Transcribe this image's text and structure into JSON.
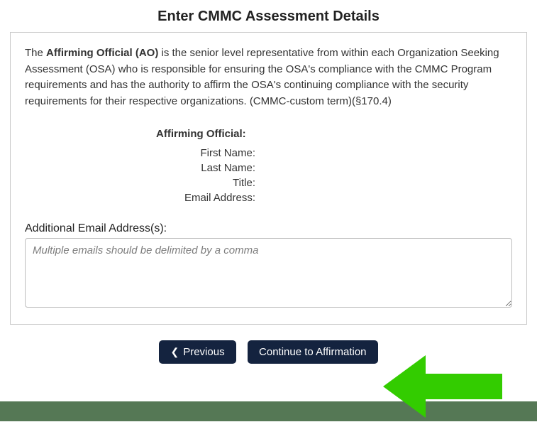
{
  "title": "Enter CMMC Assessment Details",
  "description": {
    "bold": "Affirming Official (AO)",
    "text_before": "The ",
    "text_after": " is the senior level representative from within each Organization Seeking Assessment (OSA) who is responsible for ensuring the OSA's compliance with the CMMC Program requirements and has the authority to affirm the OSA's continuing compliance with the security requirements for their respective organizations. (CMMC-custom term)(§170.4)"
  },
  "ao": {
    "heading": "Affirming Official:",
    "first_name_label": "First Name:",
    "last_name_label": "Last Name:",
    "title_label": "Title:",
    "email_label": "Email Address:",
    "first_name_value": "",
    "last_name_value": "",
    "title_value": "",
    "email_value": ""
  },
  "additional_emails": {
    "label": "Additional Email Address(s):",
    "placeholder": "Multiple emails should be delimited by a comma",
    "value": ""
  },
  "buttons": {
    "previous": "Previous",
    "continue": "Continue to Affirmation"
  }
}
